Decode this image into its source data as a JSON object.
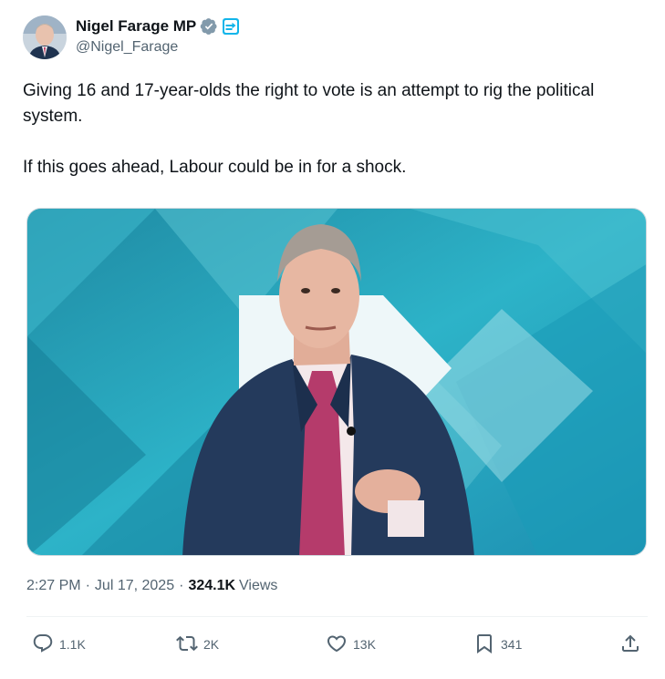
{
  "author": {
    "display_name": "Nigel Farage MP",
    "handle": "@Nigel_Farage",
    "verified_badge_color": "#829aab",
    "affiliation_badge_color": "#12b5ea"
  },
  "tweet": {
    "paragraphs": [
      "Giving 16 and 17-year-olds the right to vote is an attempt to rig the political system.",
      "If this goes ahead, Labour could be in for a shock."
    ]
  },
  "media": {
    "type": "video-thumbnail",
    "background_color": "#2aa4bd"
  },
  "meta": {
    "time": "2:27 PM",
    "date": "Jul 17, 2025",
    "separator": "·",
    "views_count": "324.1K",
    "views_label": "Views"
  },
  "actions": {
    "reply_count": "1.1K",
    "repost_count": "2K",
    "like_count": "13K",
    "bookmark_count": "341"
  },
  "icons": [
    "reply-icon",
    "repost-icon",
    "like-icon",
    "bookmark-icon",
    "share-icon",
    "verified-icon",
    "affiliation-icon"
  ]
}
